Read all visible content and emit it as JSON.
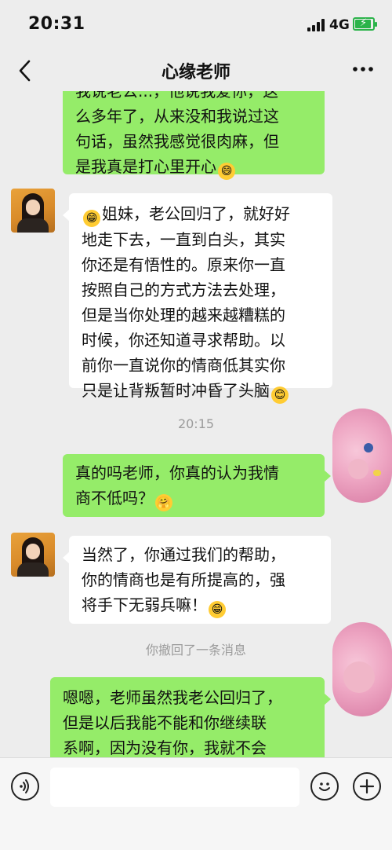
{
  "status_bar": {
    "time": "20:31",
    "network": "4G"
  },
  "header": {
    "title": "心缘老师"
  },
  "messages": [
    {
      "id": "m1",
      "side": "out",
      "lines": [
        "我说老公...，他说我爱你，这",
        "么多年了，从来没和我说过这",
        "句话，虽然我感觉很肉麻，但",
        "是我真是打心里开心"
      ],
      "emoji": "😄"
    },
    {
      "id": "m2",
      "side": "in",
      "lines": [
        "姐妹，老公回归了，就好好",
        "地走下去，一直到白头，其实",
        "你还是有悟性的。原来你一直",
        "按照自己的方式方法去处理，",
        "但是当你处理的越来越糟糕的",
        "时候，你还知道寻求帮助。以",
        "前你一直说你的情商低其实你",
        "只是让背叛暂时冲昏了头脑"
      ],
      "lead_emoji": "😁",
      "emoji": "😊"
    },
    {
      "id": "m3",
      "side": "out",
      "lines": [
        "真的吗老师，你真的认为我情",
        "商不低吗？"
      ],
      "emoji": "🤗"
    },
    {
      "id": "m4",
      "side": "in",
      "lines": [
        "当然了，你通过我们的帮助，",
        "你的情商也是有所提高的，强",
        "将手下无弱兵嘛！"
      ],
      "emoji": "😁"
    },
    {
      "id": "m5",
      "side": "out",
      "lines": [
        "嗯嗯，老师虽然我老公回归了，",
        "但是以后我能不能和你继续联",
        "系啊，因为没有你，我就不会"
      ]
    }
  ],
  "timestamp": "20:15",
  "system_message": "你撤回了一条消息",
  "input": {
    "placeholder": ""
  },
  "colors": {
    "outgoing_bubble": "#95ec69",
    "incoming_bubble": "#ffffff",
    "background": "#ededed"
  }
}
